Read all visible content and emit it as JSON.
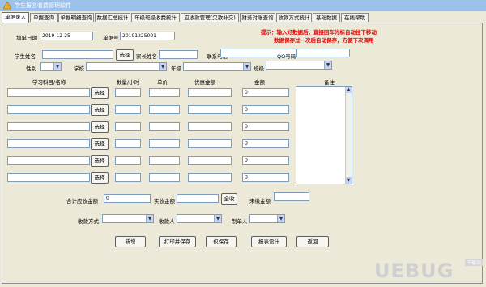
{
  "window": {
    "title": "学生报名收费管理软件"
  },
  "tabs": [
    "单据录入",
    "单据查询",
    "单据明细查询",
    "数据汇总统计",
    "年级班级收费统计",
    "应收款管理(欠款补交)",
    "财务对账查询",
    "收款方式统计",
    "基础数据",
    "在线帮助"
  ],
  "header": {
    "date_label": "填单日期",
    "date_value": "2019-12-25",
    "receipt_label": "单据号",
    "receipt_value": "20191225001",
    "tip_line1": "提示：输入好数据后，直接回车光标自动往下移动",
    "tip_line2": "数据保存过一次后自动保存，方便下次调用"
  },
  "student": {
    "name_label": "学生姓名",
    "name_value": "",
    "select_label": "选择",
    "parent_label": "家长姓名",
    "parent_value": "",
    "phone_label": "联系电话",
    "phone_value": "",
    "qq_label": "QQ号码",
    "qq_value": "",
    "gender_label": "性别",
    "school_label": "学校",
    "grade_label": "年级",
    "class_label": "班级"
  },
  "items": {
    "col_subject": "学习科目/名称",
    "col_qty": "数量/小时",
    "col_price": "单价",
    "col_discount": "优惠金额",
    "col_amount": "金额",
    "col_note": "备注",
    "select_label": "选择",
    "rows": [
      {
        "amount": "0"
      },
      {
        "amount": "0"
      },
      {
        "amount": "0"
      },
      {
        "amount": "0"
      },
      {
        "amount": "0"
      },
      {
        "amount": "0"
      }
    ]
  },
  "totals": {
    "total_label": "合计应收金额",
    "total_value": "0",
    "received_label": "实收金额",
    "received_value": "",
    "all_button": "全收",
    "unpaid_label": "未缴金额",
    "unpaid_value": "",
    "method_label": "收款方式",
    "payee_label": "收款人",
    "maker_label": "制单人"
  },
  "actions": {
    "new": "新增",
    "print_save": "打印并保存",
    "save_only": "仅保存",
    "report_design": "报表设计",
    "back": "返回"
  },
  "watermark": {
    "text": "UEBUG",
    "badge": "下载站"
  },
  "colors": {
    "tip": "#e00000",
    "titlebar": "#9cc2ea",
    "background": "#ece9d8"
  }
}
